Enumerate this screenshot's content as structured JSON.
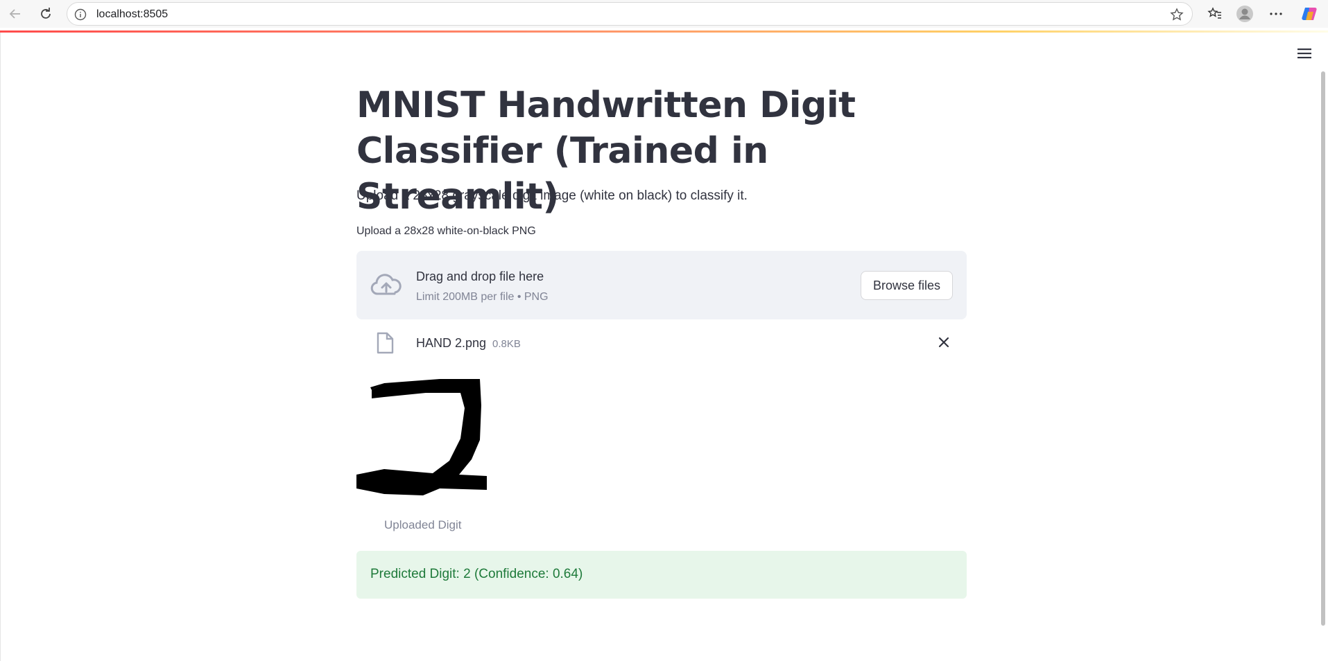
{
  "browser": {
    "url": "localhost:8505"
  },
  "app": {
    "title": "MNIST Handwritten Digit Classifier (Trained in Streamlit)",
    "description": "Upload a 28x28 grayscale digit image (white on black) to classify it."
  },
  "uploader": {
    "label": "Upload a 28x28 white-on-black PNG",
    "drop_title": "Drag and drop file here",
    "drop_limit": "Limit 200MB per file • PNG",
    "browse_label": "Browse files"
  },
  "file": {
    "name": "HAND 2.png",
    "size": "0.8KB"
  },
  "image": {
    "caption": "Uploaded Digit"
  },
  "result": {
    "text": "Predicted Digit: 2 (Confidence: 0.64)"
  },
  "colors": {
    "accent": "#ff4b4b",
    "success_bg": "#e7f6ea",
    "success_text": "#1e7a3a"
  },
  "icons": {
    "back": "arrow-left-icon",
    "reload": "reload-icon",
    "info": "info-icon",
    "star": "star-icon",
    "favorites": "favorites-icon",
    "profile": "profile-icon",
    "more": "more-icon",
    "copilot": "copilot-icon",
    "menu": "hamburger-menu-icon",
    "upload": "cloud-upload-icon",
    "file": "file-icon",
    "close": "close-icon"
  }
}
